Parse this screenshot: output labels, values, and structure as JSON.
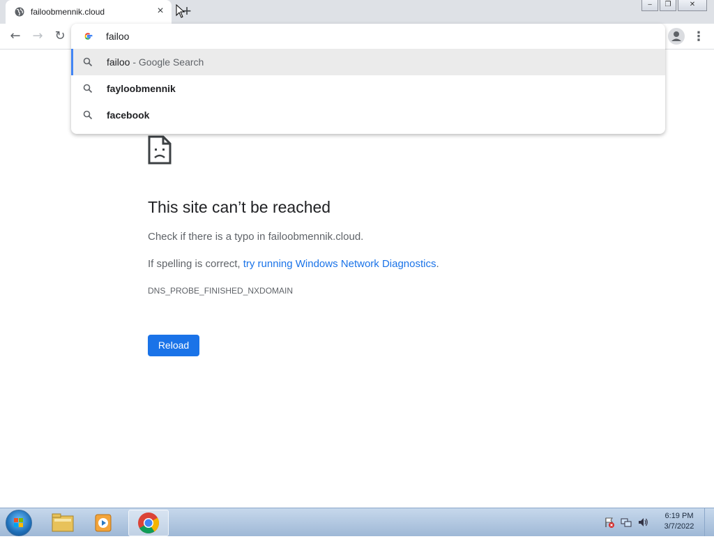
{
  "tab": {
    "title": "failoobmennik.cloud",
    "close_glyph": "×",
    "new_tab_glyph": "+"
  },
  "window_controls": {
    "minimize": "‒",
    "restore": "❐",
    "close": "✕"
  },
  "toolbar": {
    "back_glyph": "←",
    "forward_glyph": "→",
    "reload_glyph": "↻",
    "menu_glyph": "⋮"
  },
  "omnibox": {
    "g_logo": "G",
    "input_value": "failoo",
    "suggestions": [
      {
        "query": "failoo",
        "separator": " - ",
        "suffix": "Google Search"
      },
      {
        "query": "fayloobmennik",
        "separator": "",
        "suffix": ""
      },
      {
        "query": "facebook",
        "separator": "",
        "suffix": ""
      }
    ]
  },
  "error_page": {
    "title": "This site can’t be reached",
    "line1": "Check if there is a typo in failoobmennik.cloud.",
    "line2_prefix": "If spelling is correct, ",
    "line2_link": "try running Windows Network Diagnostics",
    "line2_suffix": ".",
    "error_code": "DNS_PROBE_FINISHED_NXDOMAIN",
    "reload_label": "Reload"
  },
  "taskbar": {
    "time": "6:19 PM",
    "date": "3/7/2022"
  },
  "colors": {
    "accent": "#1a73e8",
    "tabstrip": "#dee1e6",
    "selected_suggestion": "#ebebeb",
    "selection_bar": "#4285f4"
  }
}
